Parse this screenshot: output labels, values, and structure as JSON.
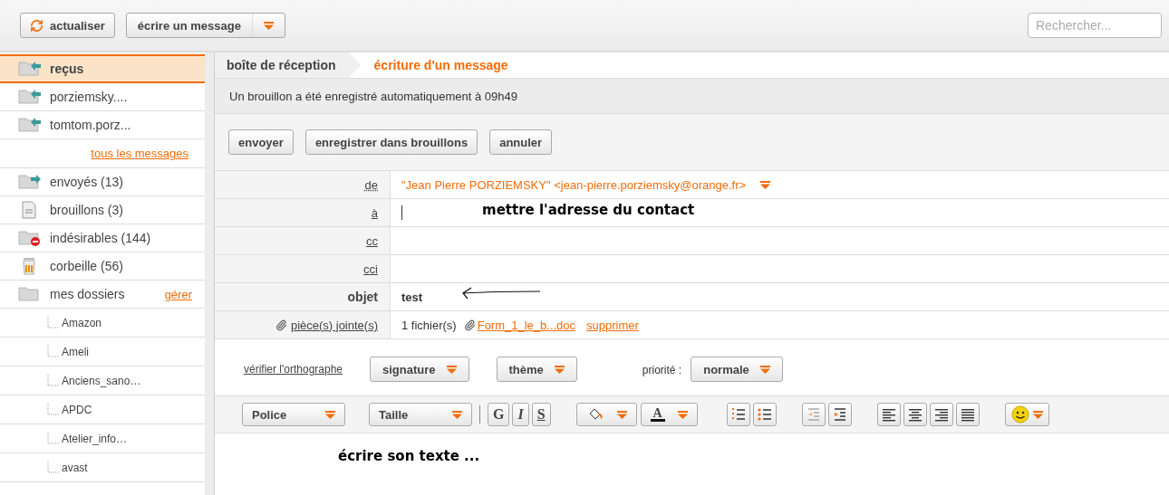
{
  "toolbar": {
    "buttons": [
      {
        "kind": "refresh",
        "label": "actualiser"
      },
      {
        "kind": "split",
        "label": "écrire un message"
      }
    ],
    "search": {
      "placeholder": "Rechercher..."
    }
  },
  "sidebar": {
    "items": [
      {
        "kind": "inbox",
        "label": "reçus",
        "selected": true
      },
      {
        "kind": "inbox",
        "label": "porziemsky....",
        "selected": false
      },
      {
        "kind": "inbox",
        "label": "tomtom.porz...",
        "selected": false
      },
      {
        "kind": "link",
        "label": "tous les messages"
      },
      {
        "kind": "sent",
        "label": "envoyés (13)",
        "selected": false
      },
      {
        "kind": "drafts",
        "label": "brouillons (3)",
        "selected": false
      },
      {
        "kind": "spam",
        "label": "indésirables (144)",
        "selected": false
      },
      {
        "kind": "trash",
        "label": "corbeille (56)",
        "selected": false
      },
      {
        "kind": "group",
        "label": "mes dossiers",
        "action": "gérer",
        "selected": false,
        "children": [
          {
            "label": "Amazon",
            "selected": false
          },
          {
            "label": "Ameli",
            "selected": false
          },
          {
            "label": "Anciens_sano…",
            "selected": false
          },
          {
            "label": "APDC",
            "selected": false
          },
          {
            "label": "Atelier_info…",
            "selected": false
          },
          {
            "label": "avast",
            "selected": false
          }
        ]
      }
    ]
  },
  "compose": {
    "breadcrumb": [
      {
        "label": "boîte de réception",
        "selected": false
      },
      {
        "label": "écriture d'un message",
        "selected": true
      }
    ],
    "notice": "Un brouillon a été enregistré automatiquement à 09h49",
    "actions": [
      "envoyer",
      "enregistrer dans brouillons",
      "annuler"
    ],
    "fields": [
      {
        "kind": "from",
        "label": "de",
        "value": "\"Jean Pierre PORZIEMSKY\" <jean-pierre.porziemsky@orange.fr>"
      },
      {
        "kind": "to",
        "label": "à",
        "note": "mettre l'adresse du contact"
      },
      {
        "kind": "address",
        "label": "cc"
      },
      {
        "kind": "address",
        "label": "cci"
      },
      {
        "kind": "subject",
        "label": "objet",
        "value": "test"
      },
      {
        "kind": "attachments",
        "label": "pièce(s) jointe(s)",
        "count": "1 fichier(s)",
        "file": "Form_1_le_b...doc",
        "remove": "supprimer"
      }
    ],
    "options": {
      "spellcheck": "vérifier l'orthographe",
      "signature": "signature",
      "theme": "thème",
      "priority_label": "priorité :",
      "priority": "normale"
    },
    "format": {
      "font": "Police",
      "size": "Taille",
      "styles": [
        "G",
        "I",
        "S"
      ],
      "text_color_letter": "A"
    },
    "editor": {
      "note": "écrire son texte ..."
    }
  }
}
